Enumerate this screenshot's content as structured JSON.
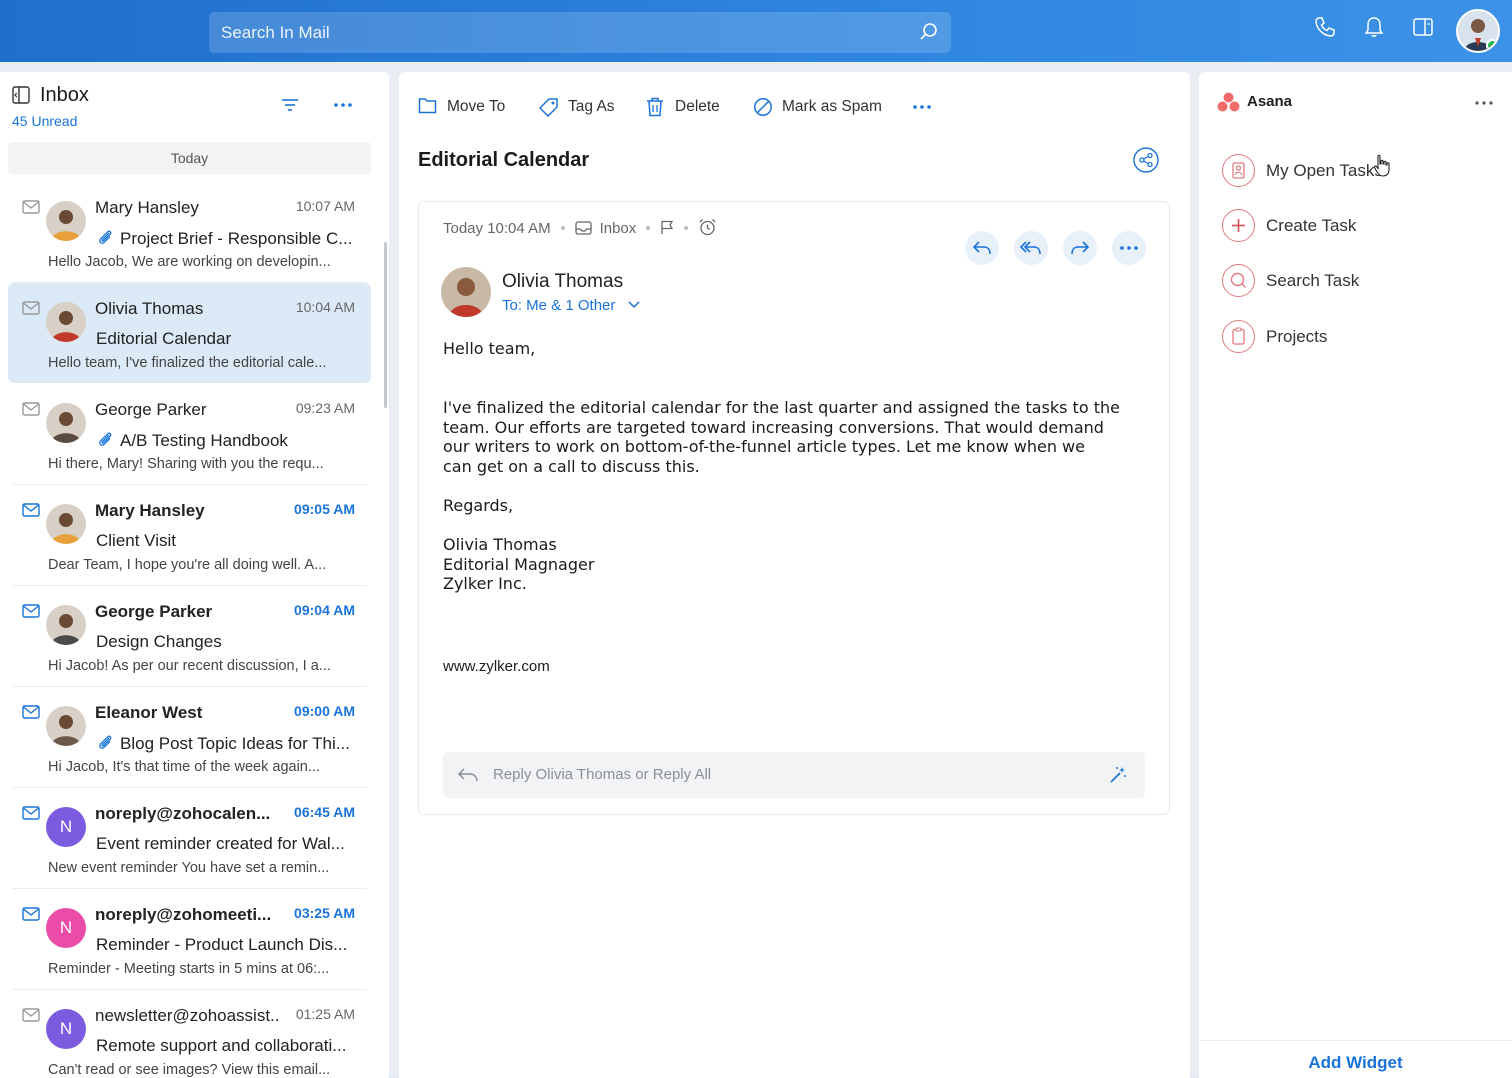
{
  "search": {
    "placeholder": "Search In Mail"
  },
  "inbox": {
    "title": "Inbox",
    "unread": "45 Unread",
    "group": "Today"
  },
  "mails": [
    {
      "sender": "Mary Hansley",
      "time": "10:07 AM",
      "subject": "Project Brief - Responsible C...",
      "preview": "Hello Jacob, We are working on developin...",
      "unread": false,
      "attachment": true,
      "avatar": "photo"
    },
    {
      "sender": "Olivia Thomas",
      "time": "10:04 AM",
      "subject": "Editorial Calendar",
      "preview": "Hello team, I've finalized the editorial cale...",
      "unread": false,
      "attachment": false,
      "avatar": "photo",
      "selected": true
    },
    {
      "sender": "George Parker",
      "time": "09:23 AM",
      "subject": "A/B Testing Handbook",
      "preview": "Hi there, Mary! Sharing with you the requ...",
      "unread": false,
      "attachment": true,
      "avatar": "photo"
    },
    {
      "sender": "Mary Hansley",
      "time": "09:05 AM",
      "subject": "Client Visit",
      "preview": "Dear Team, I hope you're all doing well. A...",
      "unread": true,
      "attachment": false,
      "avatar": "photo"
    },
    {
      "sender": "George Parker",
      "time": "09:04 AM",
      "subject": "Design Changes",
      "preview": "Hi Jacob! As per our recent discussion, I a...",
      "unread": true,
      "attachment": false,
      "avatar": "photo"
    },
    {
      "sender": "Eleanor West",
      "time": "09:00 AM",
      "subject": "Blog Post Topic Ideas for Thi...",
      "preview": "Hi Jacob, It's that time of the week again...",
      "unread": true,
      "attachment": true,
      "avatar": "photo"
    },
    {
      "sender": "noreply@zohocalen...",
      "time": "06:45 AM",
      "subject": "Event reminder created for Wal...",
      "preview": "New event reminder You have set a remin...",
      "unread": true,
      "attachment": false,
      "avatar": "N",
      "avatar_color": "#7b5ce0"
    },
    {
      "sender": "noreply@zohomeeti...",
      "time": "03:25 AM",
      "subject": "Reminder - Product Launch Dis...",
      "preview": "Reminder - Meeting starts in 5 mins at 06:...",
      "unread": true,
      "attachment": false,
      "avatar": "N",
      "avatar_color": "#ea4ca8"
    },
    {
      "sender": "newsletter@zohoassist...",
      "time": "01:25 AM",
      "subject": "Remote support and collaborati...",
      "preview": "Can't read or see images? View this email...",
      "unread": false,
      "attachment": false,
      "avatar": "N",
      "avatar_color": "#7b5ce0"
    }
  ],
  "toolbar": {
    "move_to": "Move To",
    "tag_as": "Tag As",
    "delete": "Delete",
    "mark_spam": "Mark as Spam"
  },
  "message": {
    "subject": "Editorial Calendar",
    "date": "Today 10:04 AM",
    "folder": "Inbox",
    "sender": "Olivia Thomas",
    "to": "To: Me & 1 Other",
    "greeting": "Hello team,",
    "para_lines": [
      "I've finalized the editorial calendar for the last quarter and assigned the tasks to the",
      "team. Our efforts are targeted toward increasing conversions. That would demand",
      "our writers to work on bottom-of-the-funnel article types. Let me know when we",
      "can get on a call to discuss this."
    ],
    "regards": "Regards,",
    "signature": [
      "Olivia Thomas",
      "Editorial Magnager",
      "Zylker Inc."
    ],
    "website": "www.zylker.com",
    "reply_placeholder": "Reply Olivia Thomas or Reply All"
  },
  "side": {
    "title": "Asana",
    "items": [
      "My Open Tasks",
      "Create Task",
      "Search Task",
      "Projects"
    ],
    "add_widget": "Add Widget"
  },
  "colors": {
    "accent": "#1a73d9",
    "header": "#2f86e0",
    "selected_row": "#dce9f7",
    "asana": "#f06a6a"
  }
}
